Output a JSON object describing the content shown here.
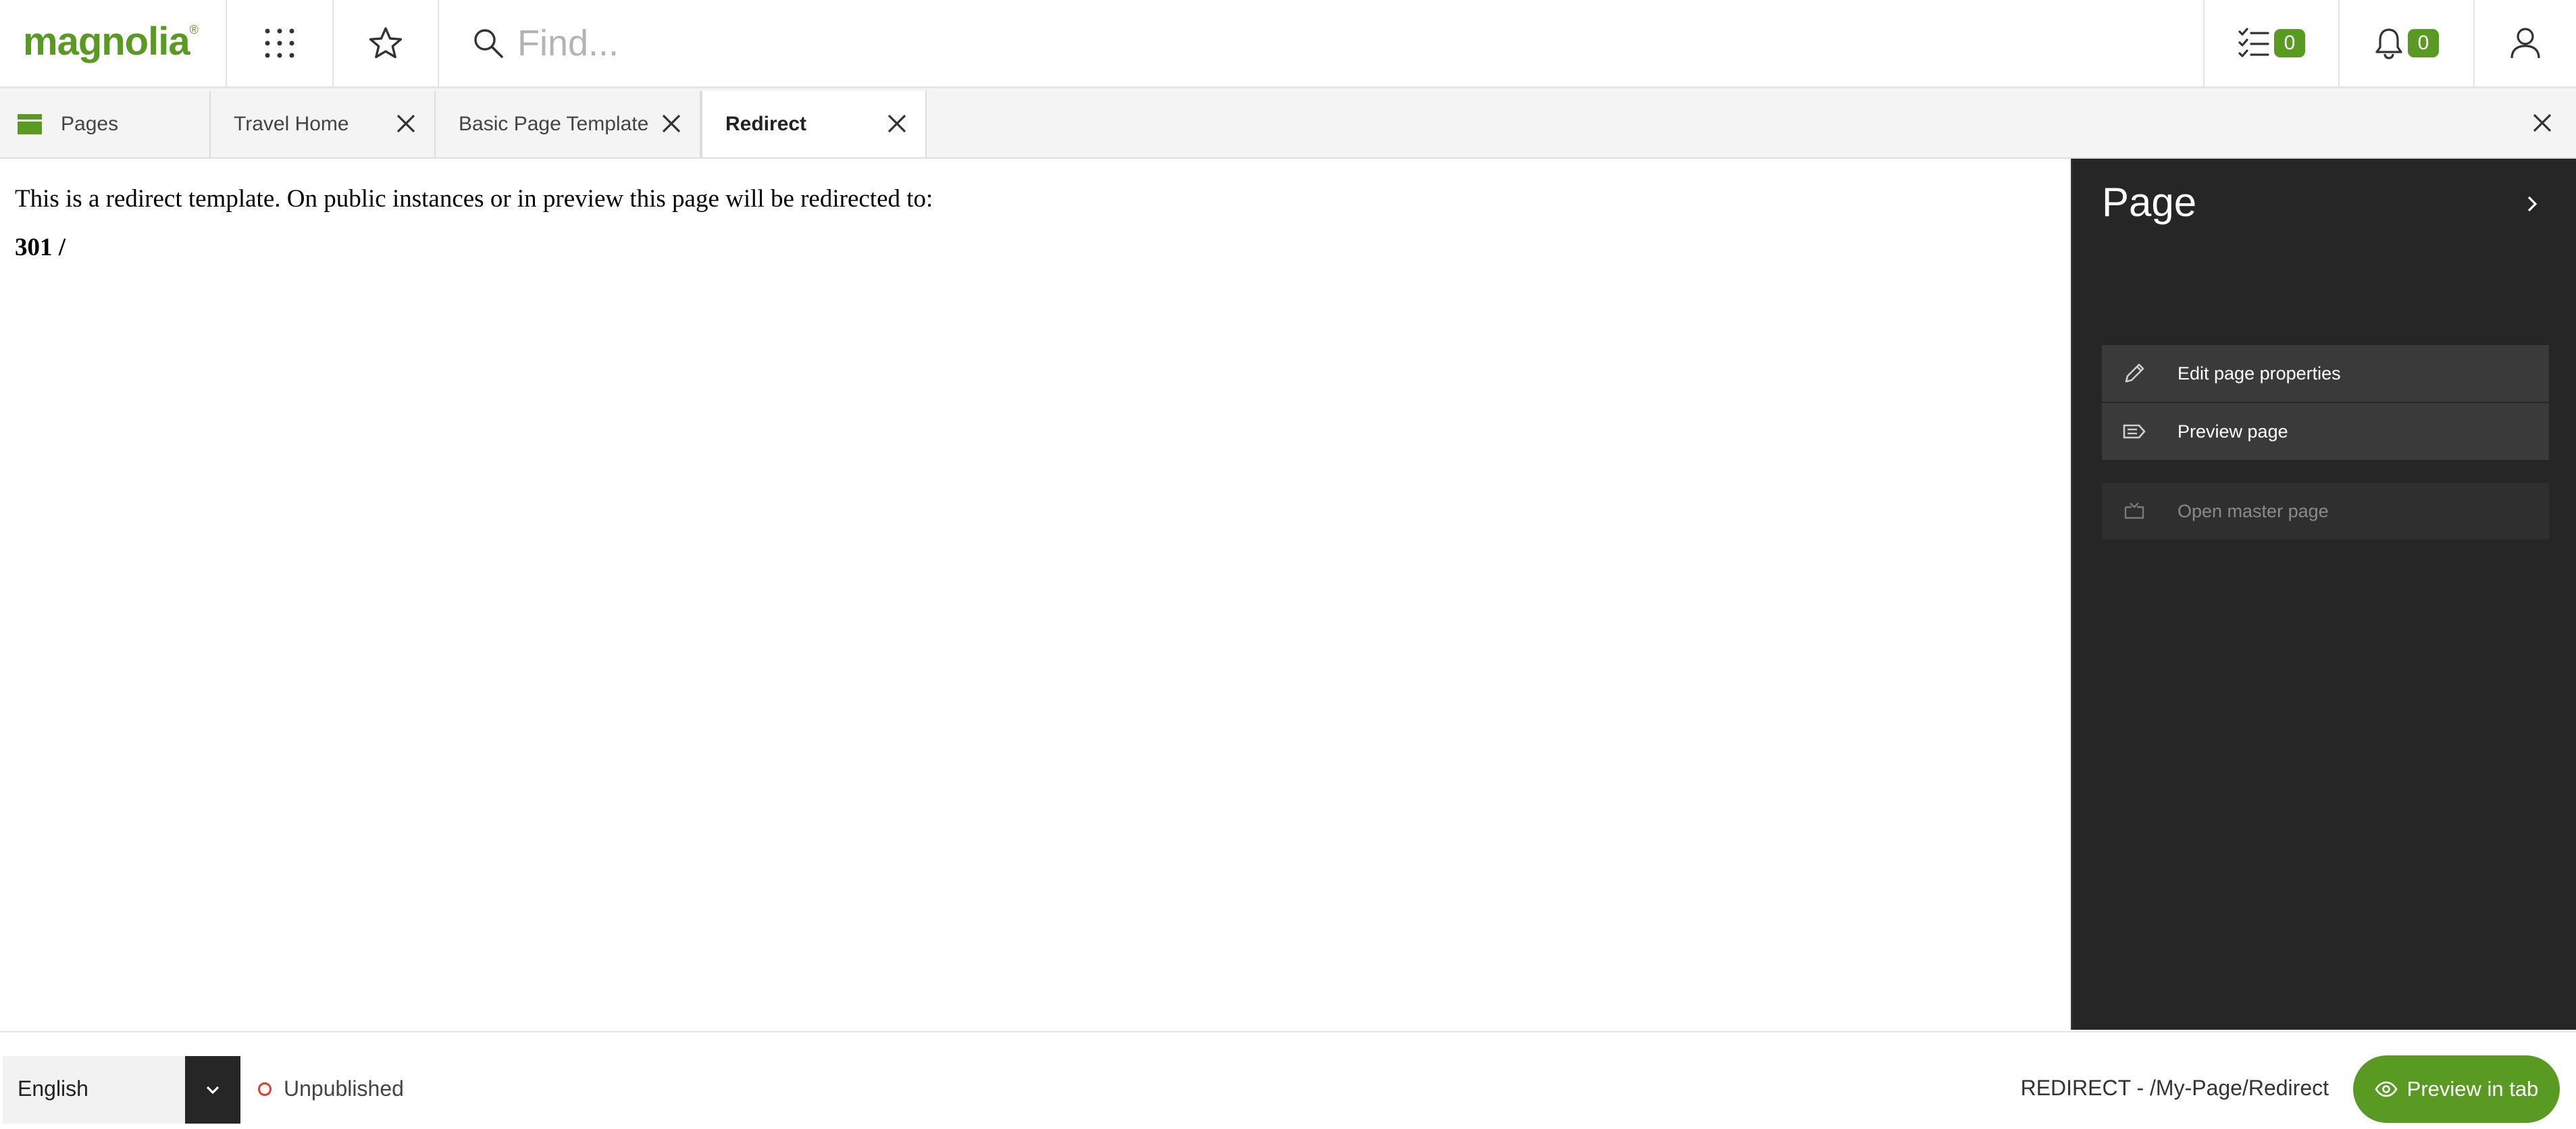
{
  "app": {
    "logo_text": "magnolia",
    "logo_mark": "®"
  },
  "topbar": {
    "search": {
      "placeholder": "Find..."
    },
    "tasks": {
      "icon": "tasks-icon",
      "count": "0"
    },
    "notifications": {
      "icon": "bell-icon",
      "count": "0"
    },
    "apps_icon": "grid-icon",
    "favorites_icon": "star-icon",
    "user_icon": "user-icon"
  },
  "tabs": [
    {
      "label": "Pages",
      "icon": "pages-app-icon",
      "closable": false,
      "active": false
    },
    {
      "label": "Travel Home",
      "closable": true,
      "active": false
    },
    {
      "label": "Basic Page Template",
      "closable": true,
      "active": false
    },
    {
      "label": "Redirect",
      "closable": true,
      "active": true
    }
  ],
  "content": {
    "message": "This is a redirect template. On public instances or in preview this page will be redirected to:",
    "code": "301 /"
  },
  "panel": {
    "title": "Page",
    "actions": [
      {
        "label": "Edit page properties",
        "icon": "pencil-icon",
        "enabled": true
      },
      {
        "label": "Preview page",
        "icon": "preview-tag-icon",
        "enabled": true
      },
      {
        "label": "Open master page",
        "icon": "master-page-icon",
        "enabled": false
      }
    ]
  },
  "footer": {
    "language": "English",
    "status": "Unpublished",
    "path": "REDIRECT - /My-Page/Redirect",
    "preview_button": "Preview in tab"
  },
  "colors": {
    "brand_green": "#599a23",
    "panel_bg": "#262626",
    "action_bg": "#3a3a3a",
    "unpublished_red": "#e23d28"
  }
}
